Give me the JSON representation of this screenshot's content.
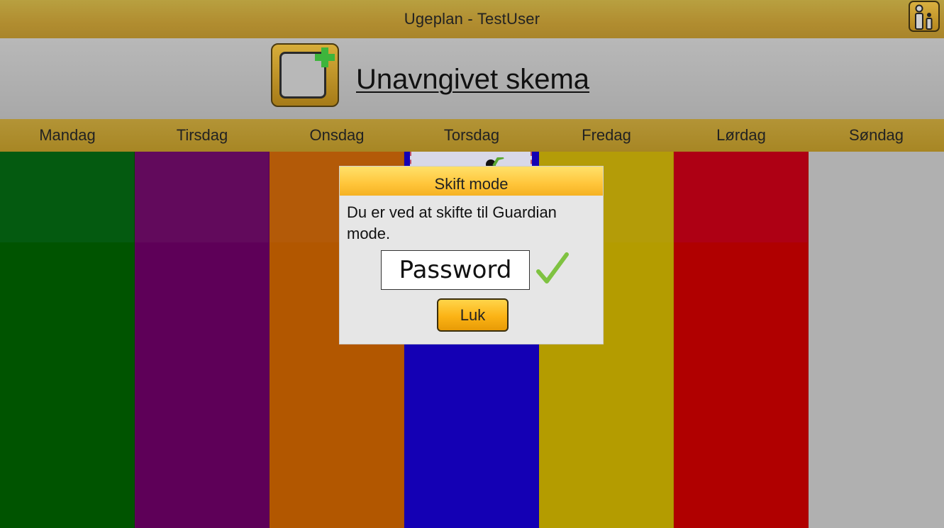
{
  "app": {
    "title": "Ugeplan - TestUser"
  },
  "header": {
    "schedule_name": "Unavngivet skema"
  },
  "days": [
    "Mandag",
    "Tirsdag",
    "Onsdag",
    "Torsdag",
    "Fredag",
    "Lørdag",
    "Søndag"
  ],
  "columns": [
    {
      "day": "Mandag",
      "color": "#005400",
      "top_color": "#045a10"
    },
    {
      "day": "Tirsdag",
      "color": "#5e0058",
      "top_color": "#620a5c"
    },
    {
      "day": "Onsdag",
      "color": "#b25700",
      "top_color": "#b35a08"
    },
    {
      "day": "Torsdag",
      "color": "#1400b4",
      "top_color": "#1400b4"
    },
    {
      "day": "Fredag",
      "color": "#b49c00",
      "top_color": "#b49c08"
    },
    {
      "day": "Lørdag",
      "color": "#b00000",
      "top_color": "#ae0014"
    },
    {
      "day": "Søndag",
      "color": "#b0b0b0",
      "top_color": "#b0b0b0"
    }
  ],
  "dialog": {
    "title": "Skift mode",
    "message": "Du er ved at skifte til Guardian mode.",
    "password_placeholder": "Password",
    "close_label": "Luk"
  },
  "colors": {
    "accent": "#b18d30",
    "dialog_header": "#ffc53a",
    "check": "#7fc241"
  },
  "icons": {
    "mode_toggle": "guardian-citizen-icon",
    "new_schedule": "add-schedule-icon",
    "confirm": "checkmark-icon"
  }
}
